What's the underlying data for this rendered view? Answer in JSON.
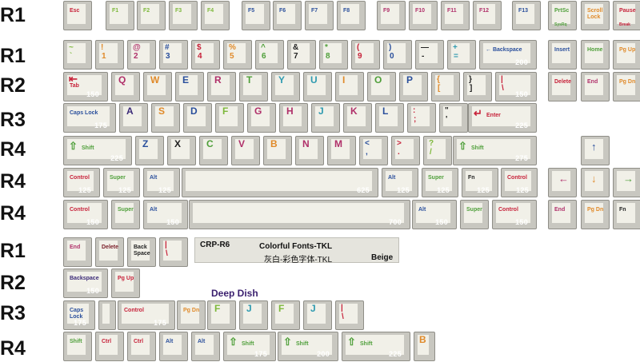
{
  "colors": {
    "red": "#c7223a",
    "green": "#4f9f3a",
    "lime": "#7db83b",
    "orange": "#e08a2a",
    "blue": "#2a4f9c",
    "teal": "#2f9ab0",
    "purple": "#3b2a78",
    "maroon": "#7a1f2a",
    "dark": "#222222",
    "magenta": "#b0306a"
  },
  "row_labels": [
    "R1",
    "R1",
    "R2",
    "R3",
    "R4",
    "R4",
    "R4",
    "R1",
    "R2",
    "R3",
    "R4"
  ],
  "info": {
    "code": "CRP-R6",
    "name": "Colorful Fonts-TKL",
    "name_cn": "灰白-彩色字体-TKL",
    "color": "Beige"
  },
  "deep_dish": "Deep Dish",
  "keys": [
    {
      "id": "esc",
      "label": "Esc",
      "c": "red"
    },
    {
      "id": "f1",
      "label": "F1",
      "c": "lime"
    },
    {
      "id": "f2",
      "label": "F2",
      "c": "lime"
    },
    {
      "id": "f3",
      "label": "F3",
      "c": "lime"
    },
    {
      "id": "f4",
      "label": "F4",
      "c": "lime"
    },
    {
      "id": "f5",
      "label": "F5",
      "c": "blue"
    },
    {
      "id": "f6",
      "label": "F6",
      "c": "blue"
    },
    {
      "id": "f7",
      "label": "F7",
      "c": "blue"
    },
    {
      "id": "f8",
      "label": "F8",
      "c": "blue"
    },
    {
      "id": "f9",
      "label": "F9",
      "c": "magenta"
    },
    {
      "id": "f10",
      "label": "F10",
      "c": "magenta"
    },
    {
      "id": "f11",
      "label": "F11",
      "c": "magenta"
    },
    {
      "id": "f12",
      "label": "F12",
      "c": "magenta"
    },
    {
      "id": "f13",
      "label": "F13",
      "c": "blue"
    },
    {
      "id": "prtsc",
      "label": "PrtSc",
      "sub": "SysRq",
      "c": "green"
    },
    {
      "id": "scroll",
      "label": "Scroll\nLock",
      "c": "orange"
    },
    {
      "id": "pause",
      "label": "Pause",
      "sub": "Break",
      "c": "red"
    },
    {
      "id": "tilde",
      "label": "~",
      "sec": "`",
      "c": "lime"
    },
    {
      "id": "n1",
      "label": "!",
      "sec": "1",
      "c": "orange"
    },
    {
      "id": "n2",
      "label": "@",
      "sec": "2",
      "c": "magenta"
    },
    {
      "id": "n3",
      "label": "#",
      "sec": "3",
      "c": "blue"
    },
    {
      "id": "n4",
      "label": "$",
      "sec": "4",
      "c": "red"
    },
    {
      "id": "n5",
      "label": "%",
      "sec": "5",
      "c": "orange"
    },
    {
      "id": "n6",
      "label": "^",
      "sec": "6",
      "c": "green"
    },
    {
      "id": "n7",
      "label": "&",
      "sec": "7",
      "c": "dark"
    },
    {
      "id": "n8",
      "label": "*",
      "sec": "8",
      "c": "green"
    },
    {
      "id": "n9",
      "label": "(",
      "sec": "9",
      "c": "red"
    },
    {
      "id": "n0",
      "label": ")",
      "sec": "0",
      "c": "blue"
    },
    {
      "id": "minus",
      "label": "—",
      "sec": "-",
      "c": "dark"
    },
    {
      "id": "equal",
      "label": "+",
      "sec": "=",
      "c": "teal"
    },
    {
      "id": "bksp",
      "label": "← Backspace",
      "c": "blue",
      "uw": "200"
    },
    {
      "id": "insert",
      "label": "Insert",
      "c": "blue"
    },
    {
      "id": "home",
      "label": "Home",
      "c": "green"
    },
    {
      "id": "pgup",
      "label": "Pg Up",
      "c": "orange"
    },
    {
      "id": "tab",
      "label": "Tab",
      "c": "red",
      "uw": "150"
    },
    {
      "id": "q",
      "label": "Q",
      "c": "magenta"
    },
    {
      "id": "w",
      "label": "W",
      "c": "orange"
    },
    {
      "id": "e",
      "label": "E",
      "c": "blue"
    },
    {
      "id": "r",
      "label": "R",
      "c": "magenta"
    },
    {
      "id": "t",
      "label": "T",
      "c": "green"
    },
    {
      "id": "y",
      "label": "Y",
      "c": "teal"
    },
    {
      "id": "u",
      "label": "U",
      "c": "teal"
    },
    {
      "id": "i",
      "label": "I",
      "c": "orange"
    },
    {
      "id": "o",
      "label": "O",
      "c": "green"
    },
    {
      "id": "p",
      "label": "P",
      "c": "blue"
    },
    {
      "id": "lbr",
      "label": "{",
      "sec": "[",
      "c": "orange"
    },
    {
      "id": "rbr",
      "label": "}",
      "sec": "]",
      "c": "dark"
    },
    {
      "id": "bslash",
      "label": "|",
      "sec": "\\",
      "c": "red",
      "uw": "150"
    },
    {
      "id": "delete",
      "label": "Delete",
      "c": "red"
    },
    {
      "id": "end",
      "label": "End",
      "c": "magenta"
    },
    {
      "id": "pgdn",
      "label": "Pg Dn",
      "c": "orange"
    },
    {
      "id": "caps",
      "label": "Caps Lock",
      "c": "blue",
      "uw": "175"
    },
    {
      "id": "a",
      "label": "A",
      "c": "purple"
    },
    {
      "id": "s",
      "label": "S",
      "c": "orange"
    },
    {
      "id": "d",
      "label": "D",
      "c": "blue"
    },
    {
      "id": "f",
      "label": "F",
      "c": "lime"
    },
    {
      "id": "g",
      "label": "G",
      "c": "magenta"
    },
    {
      "id": "h",
      "label": "H",
      "c": "magenta"
    },
    {
      "id": "j",
      "label": "J",
      "c": "teal"
    },
    {
      "id": "k",
      "label": "K",
      "c": "magenta"
    },
    {
      "id": "l",
      "label": "L",
      "c": "blue"
    },
    {
      "id": "semi",
      "label": ":",
      "sec": ";",
      "c": "red"
    },
    {
      "id": "quote",
      "label": "\"",
      "sec": "'",
      "c": "dark"
    },
    {
      "id": "enter",
      "label": "Enter",
      "c": "red",
      "uw": "225"
    },
    {
      "id": "lshift",
      "label": "Shift",
      "c": "green",
      "uw": "225"
    },
    {
      "id": "z",
      "label": "Z",
      "c": "blue"
    },
    {
      "id": "x",
      "label": "X",
      "c": "dark"
    },
    {
      "id": "c",
      "label": "C",
      "c": "green"
    },
    {
      "id": "v",
      "label": "V",
      "c": "magenta"
    },
    {
      "id": "b",
      "label": "B",
      "c": "orange"
    },
    {
      "id": "n",
      "label": "N",
      "c": "magenta"
    },
    {
      "id": "m",
      "label": "M",
      "c": "magenta"
    },
    {
      "id": "comma",
      "label": "<",
      "sec": ",",
      "c": "blue"
    },
    {
      "id": "period",
      "label": ">",
      "sec": ".",
      "c": "red"
    },
    {
      "id": "slash",
      "label": "?",
      "sec": "/",
      "c": "lime"
    },
    {
      "id": "rshift",
      "label": "Shift",
      "c": "green",
      "uw": "275"
    },
    {
      "id": "up",
      "label": "↑",
      "c": "blue"
    },
    {
      "id": "lctrl",
      "label": "Control",
      "c": "red",
      "uw": "125"
    },
    {
      "id": "lsuper",
      "label": "Super",
      "c": "green",
      "uw": "125"
    },
    {
      "id": "lalt",
      "label": "Alt",
      "c": "blue",
      "uw": "125"
    },
    {
      "id": "space",
      "label": "",
      "c": "dark",
      "uw": "625"
    },
    {
      "id": "ralt",
      "label": "Alt",
      "c": "blue",
      "uw": "125"
    },
    {
      "id": "rsuper",
      "label": "Super",
      "c": "green",
      "uw": "125"
    },
    {
      "id": "fn",
      "label": "Fn",
      "c": "dark",
      "uw": "125"
    },
    {
      "id": "rctrl",
      "label": "Control",
      "c": "red",
      "uw": "125"
    },
    {
      "id": "left",
      "label": "←",
      "c": "magenta"
    },
    {
      "id": "down",
      "label": "↓",
      "c": "orange"
    },
    {
      "id": "right",
      "label": "→",
      "c": "green"
    },
    {
      "id": "lctrl2",
      "label": "Control",
      "c": "red",
      "uw": "150"
    },
    {
      "id": "lsuper2",
      "label": "Super",
      "c": "green"
    },
    {
      "id": "lalt2",
      "label": "Alt",
      "c": "blue",
      "uw": "150"
    },
    {
      "id": "space2",
      "label": "",
      "c": "dark",
      "uw": "700"
    },
    {
      "id": "ralt2",
      "label": "Alt",
      "c": "blue",
      "uw": "150"
    },
    {
      "id": "rsuper2",
      "label": "Super",
      "c": "green"
    },
    {
      "id": "rctrl2",
      "label": "Control",
      "c": "red",
      "uw": "150"
    },
    {
      "id": "end2",
      "label": "End",
      "c": "magenta"
    },
    {
      "id": "pgdn2",
      "label": "Pg Dn",
      "c": "orange"
    },
    {
      "id": "fn2",
      "label": "Fn",
      "c": "dark"
    },
    {
      "id": "x_end",
      "label": "End",
      "c": "magenta"
    },
    {
      "id": "x_delete",
      "label": "Delete",
      "c": "maroon"
    },
    {
      "id": "x_bkspace",
      "label": "Back\nSpace",
      "c": "dark"
    },
    {
      "id": "x_pipe",
      "label": "|",
      "sec": "\\",
      "c": "red"
    },
    {
      "id": "x_bksp2",
      "label": "Backspace",
      "c": "purple",
      "uw": "150"
    },
    {
      "id": "x_pgup",
      "label": "Pg Up",
      "c": "red"
    },
    {
      "id": "x_caps",
      "label": "Caps\nLock",
      "c": "blue",
      "uw": "175"
    },
    {
      "id": "x_blank",
      "label": "",
      "c": "dark"
    },
    {
      "id": "x_control",
      "label": "Control",
      "c": "red",
      "uw": "175"
    },
    {
      "id": "x_pgdn",
      "label": "Pg Dn",
      "c": "orange"
    },
    {
      "id": "x_f1",
      "label": "F",
      "c": "lime"
    },
    {
      "id": "x_j1",
      "label": "J",
      "c": "teal"
    },
    {
      "id": "x_f2",
      "label": "F",
      "c": "lime"
    },
    {
      "id": "x_j2",
      "label": "J",
      "c": "teal"
    },
    {
      "id": "x_pipe2",
      "label": "|",
      "sec": "\\",
      "c": "red"
    },
    {
      "id": "x_shift1",
      "label": "Shift",
      "c": "green"
    },
    {
      "id": "x_ctrl1",
      "label": "Ctrl",
      "c": "red"
    },
    {
      "id": "x_ctrl2",
      "label": "Ctrl",
      "c": "red"
    },
    {
      "id": "x_alt1",
      "label": "Alt",
      "c": "blue"
    },
    {
      "id": "x_alt2",
      "label": "Alt",
      "c": "blue"
    },
    {
      "id": "x_shift175",
      "label": "Shift",
      "c": "green",
      "uw": "175"
    },
    {
      "id": "x_shift200",
      "label": "Shift",
      "c": "green",
      "uw": "200"
    },
    {
      "id": "x_shift225",
      "label": "Shift",
      "c": "green",
      "uw": "225"
    },
    {
      "id": "x_b",
      "label": "B",
      "c": "orange"
    }
  ]
}
